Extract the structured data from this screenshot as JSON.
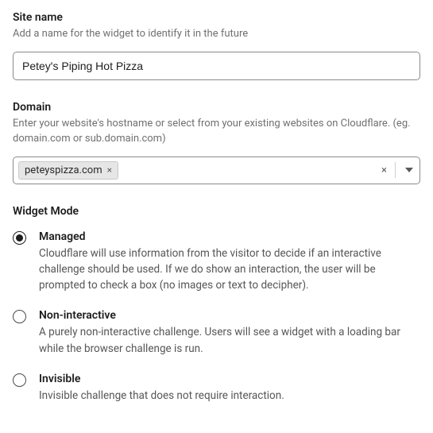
{
  "siteName": {
    "label": "Site name",
    "helper": "Add a name for the widget to identify it in the future",
    "value": "Petey's Piping Hot Pizza"
  },
  "domain": {
    "label": "Domain",
    "helper": "Enter your website's hostname or select from your existing websites on Cloudflare. (eg. domain.com or sub.domain.com)",
    "chip": "peteyspizza.com",
    "clearSymbol": "×"
  },
  "widgetMode": {
    "title": "Widget Mode",
    "options": [
      {
        "label": "Managed",
        "desc": "Cloudflare will use information from the visitor to decide if an interactive challenge should be used. If we do show an interaction, the user will be prompted to check a box (no images or text to decipher).",
        "selected": true
      },
      {
        "label": "Non-interactive",
        "desc": "A purely non-interactive challenge. Users will see a widget with a loading bar while the browser challenge is run.",
        "selected": false
      },
      {
        "label": "Invisible",
        "desc": "Invisible challenge that does not require interaction.",
        "selected": false
      }
    ]
  }
}
